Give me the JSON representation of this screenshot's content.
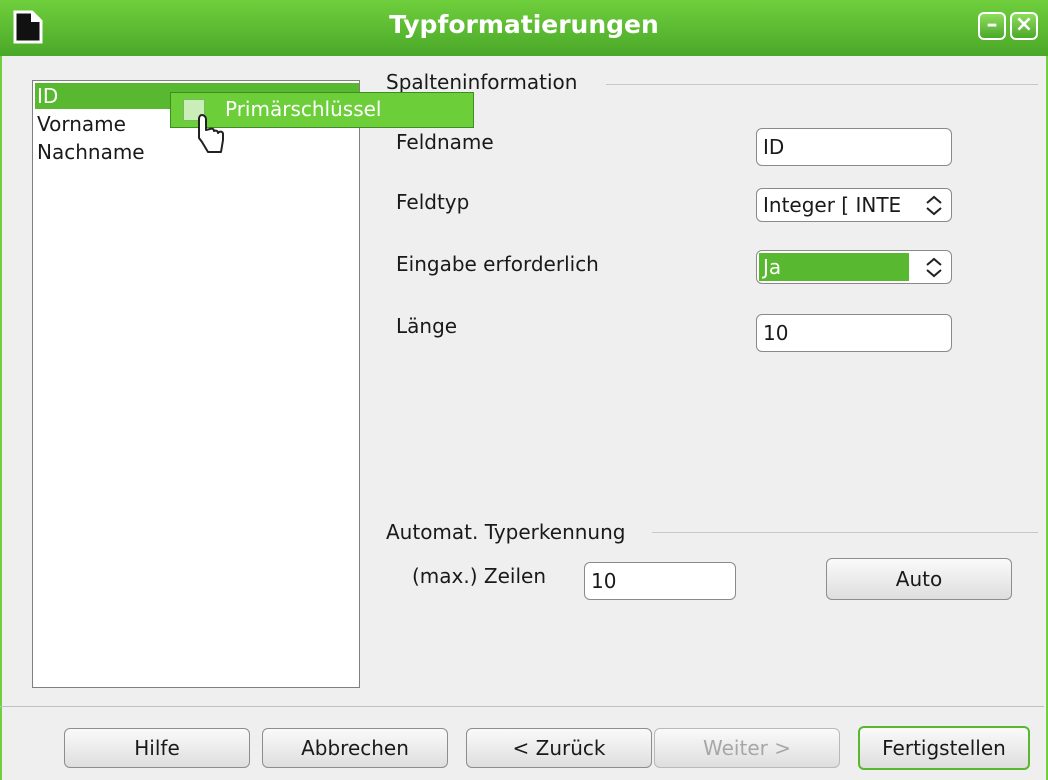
{
  "window": {
    "title": "Typformatierungen",
    "accent": "#58b830"
  },
  "list": {
    "items": [
      "ID",
      "Vorname",
      "Nachname"
    ],
    "selected_index": 0
  },
  "context_menu": {
    "item_label": "Primärschlüssel",
    "checked": false
  },
  "column_info": {
    "group_title": "Spalteninformation",
    "field_name_label": "Feldname",
    "field_name_value": "ID",
    "field_type_label": "Feldtyp",
    "field_type_value": "Integer [ INTE",
    "required_label": "Eingabe erforderlich",
    "required_value": "Ja",
    "length_label": "Länge",
    "length_value": "10"
  },
  "auto_detect": {
    "group_title": "Automat. Typerkennung",
    "rows_label": "(max.) Zeilen",
    "rows_value": "10",
    "auto_button": "Auto"
  },
  "buttons": {
    "help": "Hilfe",
    "cancel": "Abbrechen",
    "back": "< Zurück",
    "next": "Weiter >",
    "finish": "Fertigstellen"
  }
}
